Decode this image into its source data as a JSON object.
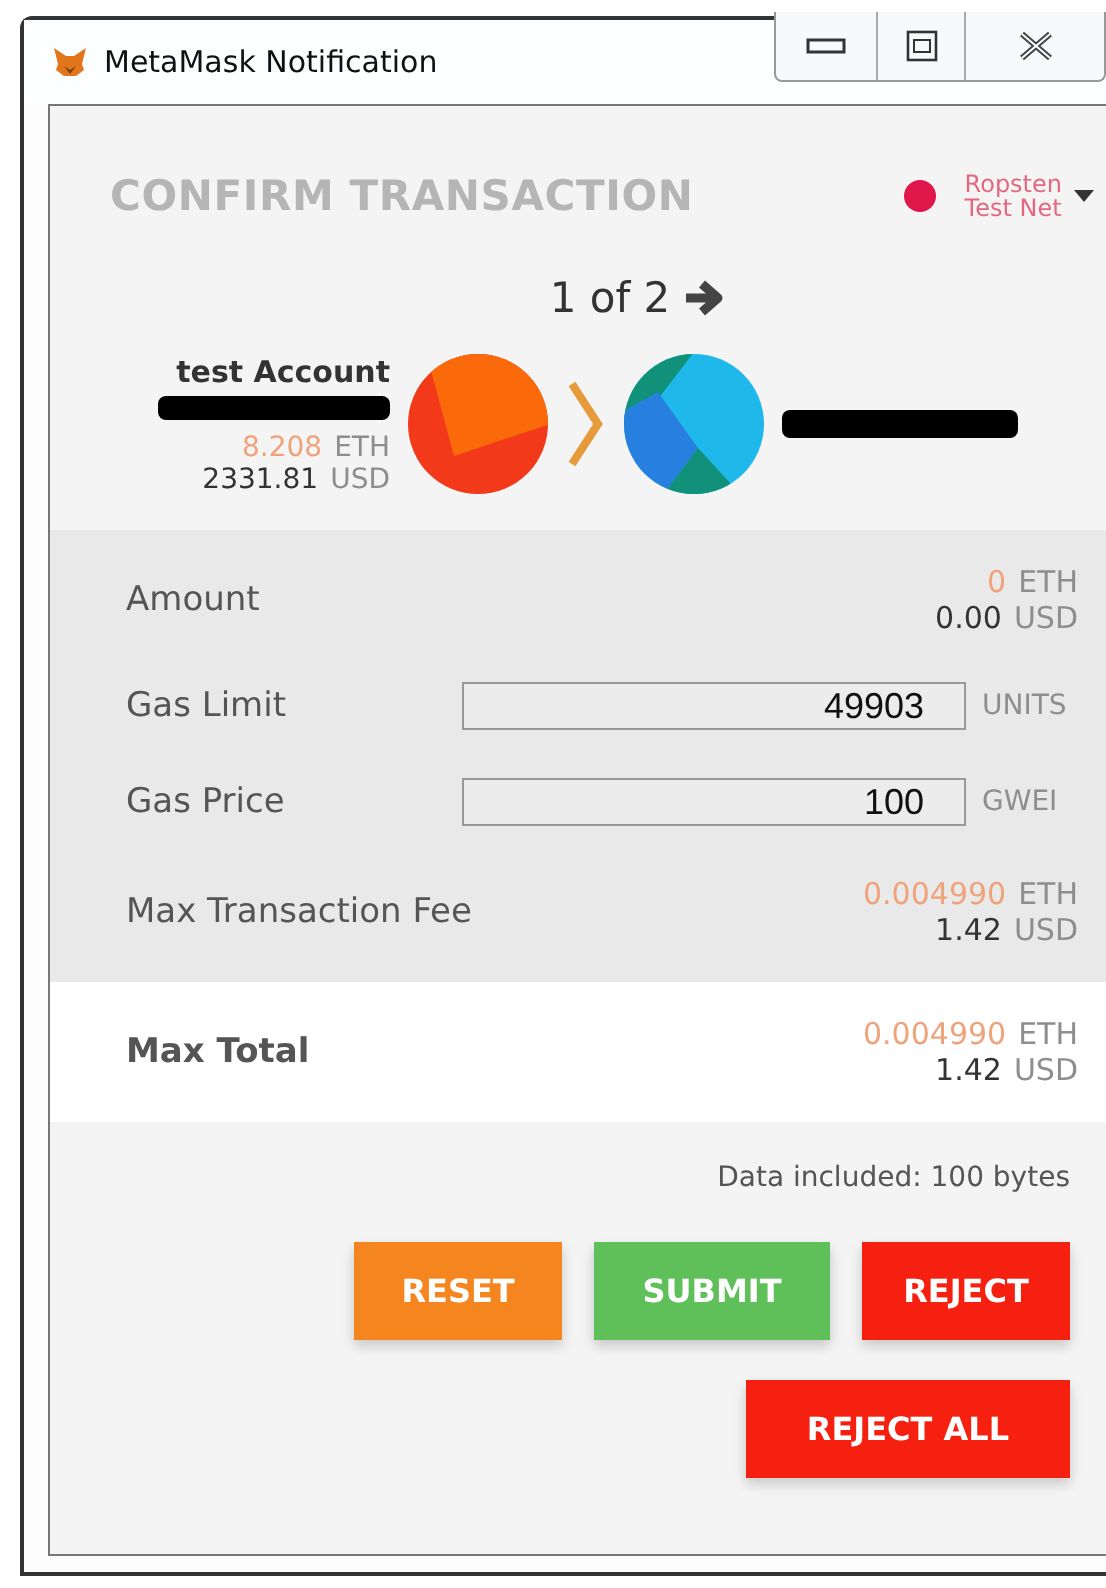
{
  "window": {
    "title": "MetaMask Notification"
  },
  "header": {
    "title": "CONFIRM TRANSACTION",
    "network": {
      "lines": [
        "Ropsten",
        "Test Net"
      ],
      "color": "#e0174a"
    }
  },
  "pagination": {
    "text": "1 of 2"
  },
  "sender": {
    "name": "test Account",
    "eth": "8.208",
    "eth_unit": "ETH",
    "usd": "2331.81",
    "usd_unit": "USD"
  },
  "details": [
    {
      "kind": "amount",
      "label": "Amount",
      "eth": "0",
      "eth_unit": "ETH",
      "usd": "0.00",
      "usd_unit": "USD"
    },
    {
      "kind": "field",
      "label": "Gas Limit",
      "value": "49903",
      "unit": "UNITS"
    },
    {
      "kind": "field",
      "label": "Gas Price",
      "value": "100",
      "unit": "GWEI"
    },
    {
      "kind": "amount",
      "label": "Max Transaction Fee",
      "eth": "0.004990",
      "eth_unit": "ETH",
      "usd": "1.42",
      "usd_unit": "USD"
    }
  ],
  "total": {
    "label": "Max Total",
    "eth": "0.004990",
    "eth_unit": "ETH",
    "usd": "1.42",
    "usd_unit": "USD"
  },
  "data_note": "Data included: 100 bytes",
  "buttons": [
    {
      "kind": "reset",
      "label": "RESET"
    },
    {
      "kind": "submit",
      "label": "SUBMIT"
    },
    {
      "kind": "reject",
      "label": "REJECT"
    },
    {
      "kind": "reject",
      "label": "REJECT ALL"
    }
  ]
}
